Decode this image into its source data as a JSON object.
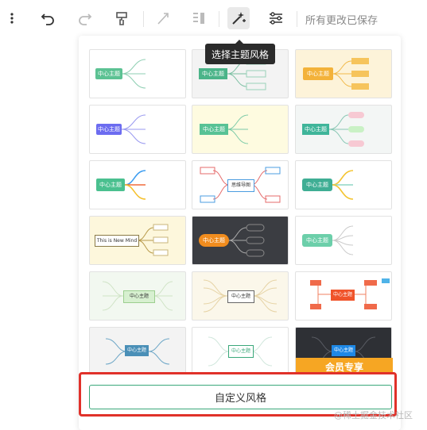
{
  "toolbar": {
    "more_icon": "more-vertical-icon",
    "undo_icon": "undo-icon",
    "redo_icon": "redo-icon",
    "format_painter_icon": "format-painter-icon",
    "connector_icon": "connector-icon",
    "layout_icon": "layout-icon",
    "theme_icon": "magic-wand-icon",
    "structure_icon": "structure-icon",
    "saved_status": "所有更改已保存"
  },
  "tooltip": "选择主题风格",
  "themes": [
    {
      "label": "中心主题",
      "style": "light-green"
    },
    {
      "label": "中心主题",
      "style": "green-box"
    },
    {
      "label": "中心主题",
      "style": "yellow"
    },
    {
      "label": "中心主题",
      "style": "purple"
    },
    {
      "label": "中心主题",
      "style": "green-on-yellow"
    },
    {
      "label": "中心主题",
      "style": "teal-pink"
    },
    {
      "label": "中心主题",
      "style": "green-multicolor"
    },
    {
      "label": "思维导图",
      "style": "red-blue-boxes"
    },
    {
      "label": "中心主题",
      "style": "teal-yellow"
    },
    {
      "label": "This is New Mind",
      "style": "cream"
    },
    {
      "label": "中心主题",
      "style": "dark-orange"
    },
    {
      "label": "中心主题",
      "style": "grey-green"
    },
    {
      "label": "中心主题",
      "style": "green-fishbone"
    },
    {
      "label": "中心主题",
      "style": "beige-wide"
    },
    {
      "label": "中心主题",
      "style": "red-orange"
    },
    {
      "label": "中心主题",
      "style": "blue-slate"
    },
    {
      "label": "中心主题",
      "style": "green-outline"
    },
    {
      "label": "中心主题",
      "style": "dark-blue"
    }
  ],
  "vip_badge": "会员专享",
  "custom_button": "自定义风格",
  "watermark": "@稀土掘金技术社区",
  "colors": {
    "accent_green": "#3aa87a",
    "highlight_red": "#e0312a",
    "vip_orange": "#f6a623"
  }
}
